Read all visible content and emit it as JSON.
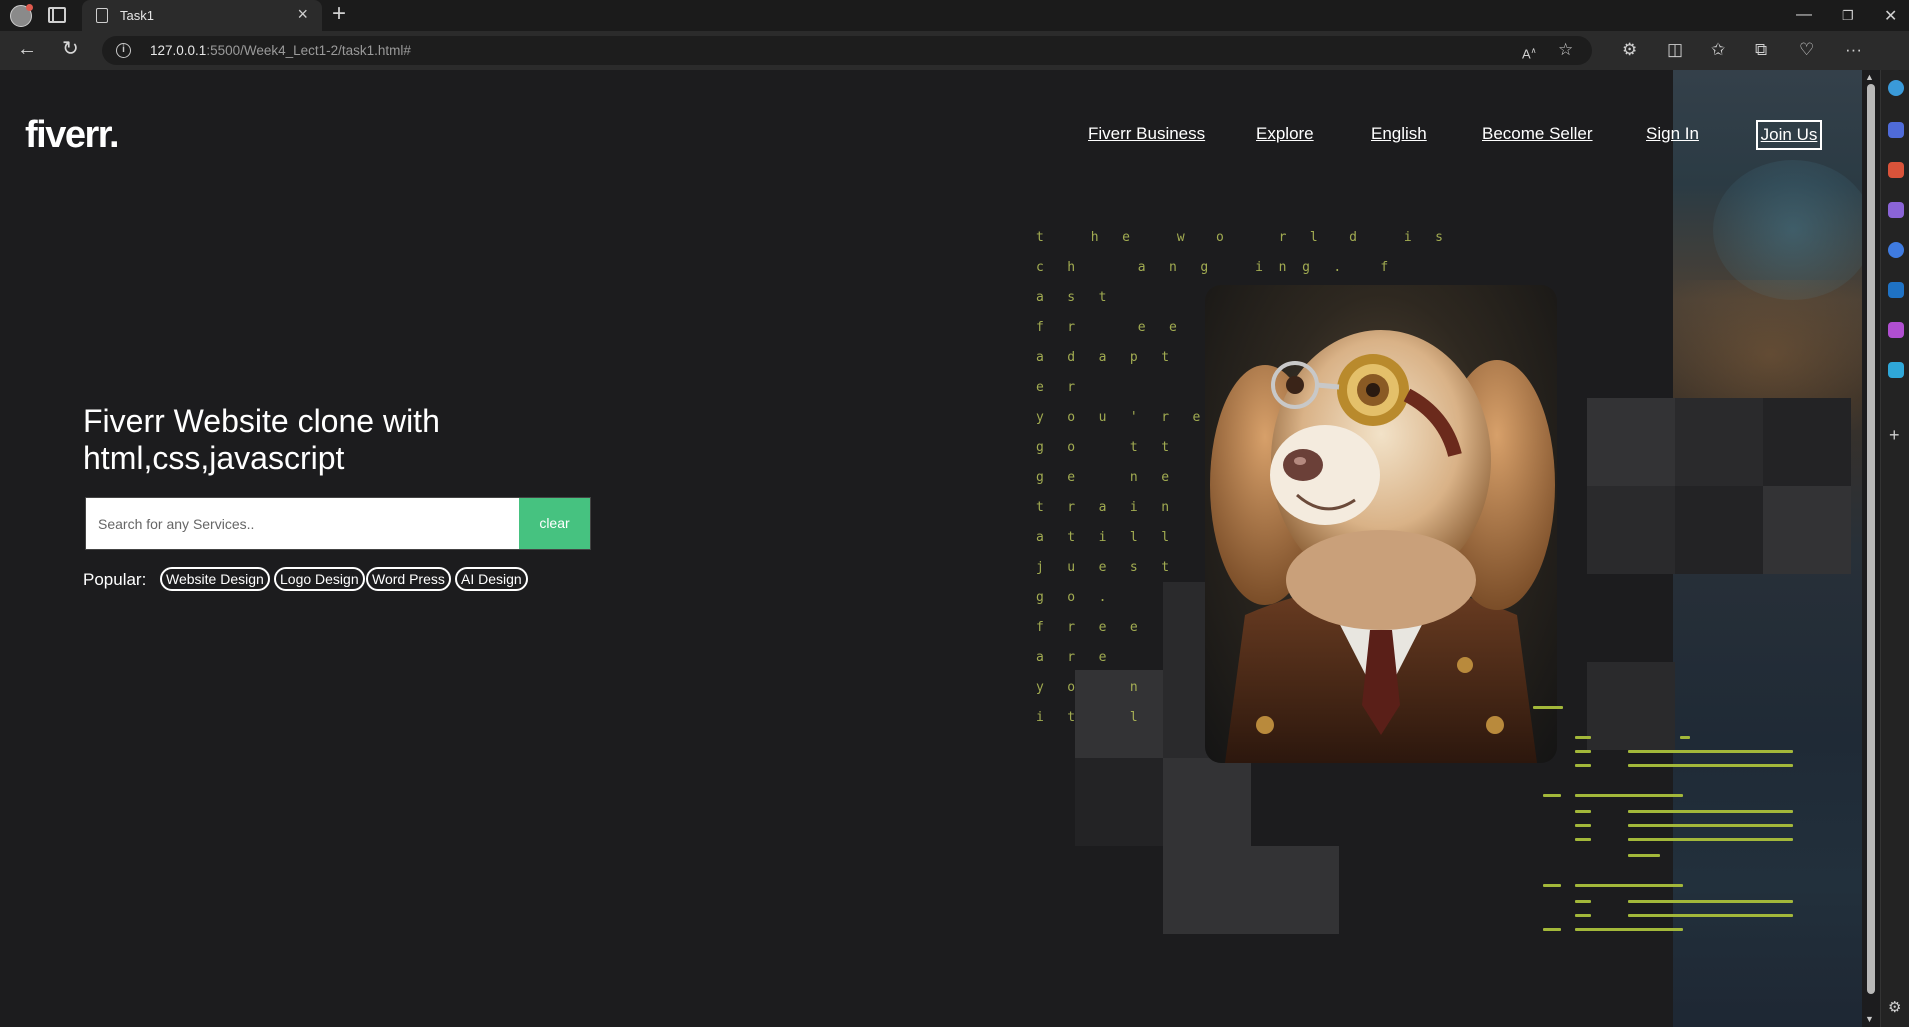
{
  "browser": {
    "tab_title": "Task1",
    "url_host": "127.0.0.1",
    "url_rest": ":5500/Week4_Lect1-2/task1.html#"
  },
  "header": {
    "logo": "fiverr.",
    "nav": [
      "Fiverr Business",
      "Explore",
      "English",
      "Become Seller",
      "Sign In"
    ],
    "join": "Join Us"
  },
  "hero": {
    "title": "Fiverr Website clone with html,css,javascript",
    "search_placeholder": "Search for any Services..",
    "clear_label": "clear",
    "popular_label": "Popular:",
    "popular_tags": [
      "Website Design",
      "Logo Design",
      "Word Press",
      "AI Design"
    ]
  },
  "decor": {
    "ascii_rows": [
      "t      h   e      w    o       r   l    d      i   s",
      "c   h        a   n   g      i  n  g   .     f",
      "a   s   t",
      "f   r        e   e",
      "a   d   a   p   t",
      "e   r",
      "y   o   u   '   r   e",
      "g   o       t   t",
      "g   e       n   e",
      "t   r   a   i   n",
      "a   t   i   l   l",
      "j   u   e   s   t",
      "g   o   .",
      "f   r   e   e",
      "a   r   e",
      "y   o       n",
      "i   t       l"
    ],
    "accent_green": "#46c280",
    "code_color": "#a3b83a"
  }
}
